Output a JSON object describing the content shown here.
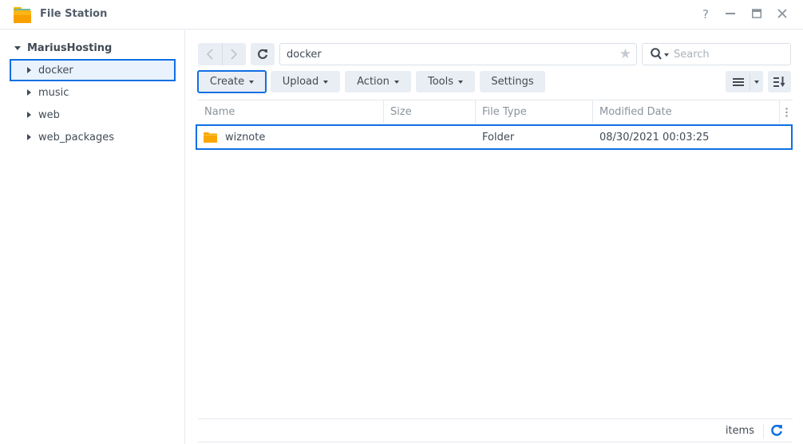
{
  "window": {
    "title": "File Station",
    "controls": {
      "help": "?",
      "minimize": "—",
      "maximize": "▭",
      "close": "✕"
    }
  },
  "sidebar": {
    "root": "MariusHosting",
    "items": [
      {
        "label": "docker",
        "selected": true
      },
      {
        "label": "music",
        "selected": false
      },
      {
        "label": "web",
        "selected": false
      },
      {
        "label": "web_packages",
        "selected": false
      }
    ]
  },
  "toolbar": {
    "back": "‹",
    "forward": "›",
    "path": "docker",
    "search_placeholder": "Search",
    "buttons": {
      "create": "Create",
      "upload": "Upload",
      "action": "Action",
      "tools": "Tools",
      "settings": "Settings"
    }
  },
  "grid": {
    "columns": [
      "Name",
      "Size",
      "File Type",
      "Modified Date"
    ],
    "rows": [
      {
        "name": "wiznote",
        "size": "",
        "type": "Folder",
        "modified": "08/30/2021 00:03:25"
      }
    ]
  },
  "footer": {
    "items_label": "items"
  },
  "colors": {
    "accent": "#0f6fe3",
    "folder": "#f9a800",
    "button_bg": "#e9eef4"
  }
}
